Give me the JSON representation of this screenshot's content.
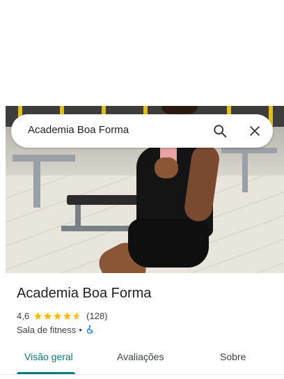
{
  "search": {
    "query": "Academia Boa Forma"
  },
  "icons": {
    "search": "search-icon",
    "close": "close-icon",
    "accessibility": "wheelchair-accessible-icon"
  },
  "place": {
    "name": "Academia Boa Forma",
    "rating": "4,6",
    "rating_value": 4.6,
    "review_count": "(128)",
    "category": "Sala de fitness",
    "separator": "•"
  },
  "tabs": [
    {
      "label": "Visão geral",
      "active": true
    },
    {
      "label": "Avaliações",
      "active": false
    },
    {
      "label": "Sobre",
      "active": false
    }
  ],
  "colors": {
    "accent": "#0b7a7a",
    "star": "#fbbc04",
    "accessibility": "#1a73e8"
  }
}
